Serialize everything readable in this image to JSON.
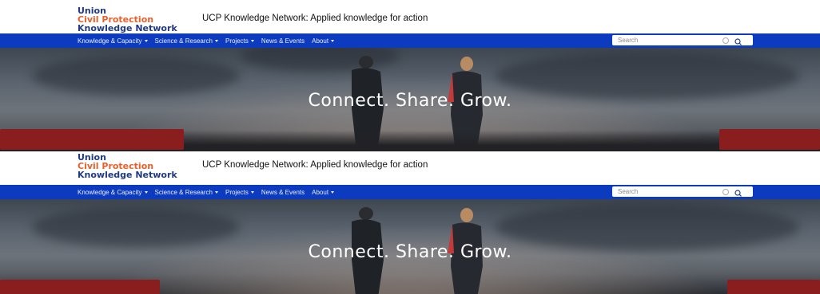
{
  "header": {
    "logo_line1": "Union",
    "logo_line2": "Civil Protection",
    "logo_line3": "Knowledge Network",
    "tagline": "UCP Knowledge Network: Applied knowledge for action"
  },
  "nav": {
    "items": [
      {
        "label": "Knowledge & Capacity",
        "dropdown": true
      },
      {
        "label": "Science & Research",
        "dropdown": true
      },
      {
        "label": "Projects",
        "dropdown": true
      },
      {
        "label": "News & Events",
        "dropdown": false
      },
      {
        "label": "About",
        "dropdown": true
      }
    ]
  },
  "search": {
    "placeholder": "Search",
    "icons": [
      "clear-icon",
      "search-icon"
    ]
  },
  "hero": {
    "title": "Connect. Share. Grow."
  },
  "colors": {
    "nav_bg": "#0d3bc0",
    "logo_blue": "#1f3a8a",
    "logo_orange": "#e8612c"
  }
}
